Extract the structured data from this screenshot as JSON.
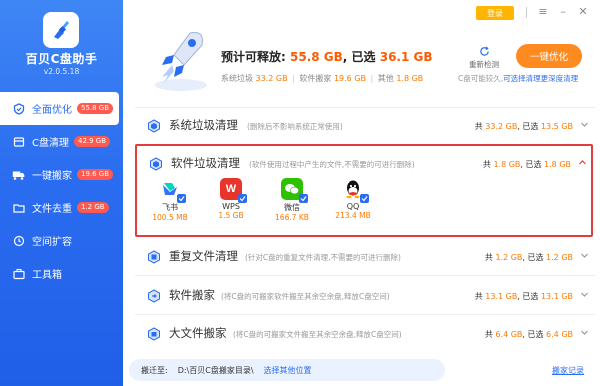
{
  "app": {
    "name": "百贝C盘助手",
    "version": "v2.0.5.18"
  },
  "header": {
    "login_label": "登录"
  },
  "nav": [
    {
      "label": "全面优化",
      "badge": "55.8 GB",
      "icon": "shield-icon",
      "active": true
    },
    {
      "label": "C盘清理",
      "badge": "42.9 GB",
      "icon": "broom-icon"
    },
    {
      "label": "一键搬家",
      "badge": "19.6 GB",
      "icon": "truck-icon"
    },
    {
      "label": "文件去重",
      "badge": "1.2 GB",
      "icon": "folder-icon"
    },
    {
      "label": "空间扩容",
      "badge": "",
      "icon": "expand-icon"
    },
    {
      "label": "工具箱",
      "badge": "",
      "icon": "toolbox-icon"
    }
  ],
  "summary": {
    "title_prefix": "预计可释放:",
    "total": "55.8 GB",
    "title_mid": ", 已选",
    "selected": "36.1 GB",
    "trash_label": "系统垃圾",
    "trash_value": "33.2 GB",
    "move_label": "软件搬家",
    "move_value": "19.6 GB",
    "other_label": "其他",
    "other_value": "1.8 GB"
  },
  "recheck_label": "重新检测",
  "optimize_label": "一键优化",
  "hint": {
    "text": "C盘可能较久,",
    "link": "可选择清理更深度清理"
  },
  "rows": [
    {
      "title": "系统垃圾清理",
      "desc": "(删除后不影响系统正常使用)",
      "total_prefix": "共",
      "total": "33.2 GB",
      "selected_prefix": ", 已选",
      "selected": "13.5 GB",
      "icon": "system-trash-icon"
    },
    {
      "title": "软件垃圾清理",
      "desc": "(软件使用过程中产生的文件,不需要的可进行删除)",
      "total_prefix": "共",
      "total": "1.8 GB",
      "selected_prefix": ", 已选",
      "selected": "1.8 GB",
      "icon": "software-trash-icon"
    },
    {
      "title": "重复文件清理",
      "desc": "(针对C盘的重复文件清理,不需要的可进行删除)",
      "total_prefix": "共",
      "total": "1.2 GB",
      "selected_prefix": ", 已选",
      "selected": "1.2 GB",
      "icon": "duplicate-icon"
    },
    {
      "title": "软件搬家",
      "desc": "(将C盘的可搬家软件搬至其余空余盘,释放C盘空间)",
      "total_prefix": "共",
      "total": "13.1 GB",
      "selected_prefix": ", 已选",
      "selected": "13.1 GB",
      "icon": "software-move-icon"
    },
    {
      "title": "大文件搬家",
      "desc": "(将C盘的可搬家文件搬至其余空余盘,释放C盘空间)",
      "total_prefix": "共",
      "total": "6.4 GB",
      "selected_prefix": ", 已选",
      "selected": "6.4 GB",
      "icon": "bigfile-move-icon"
    }
  ],
  "apps": [
    {
      "name": "飞书",
      "size": "100.5 MB",
      "icon": "feishu-icon",
      "color": "#1ec8b0"
    },
    {
      "name": "WPS",
      "size": "1.5 GB",
      "icon": "wps-icon",
      "color": "#e8342b"
    },
    {
      "name": "微信",
      "size": "166.7 KB",
      "icon": "wechat-icon",
      "color": "#2dc100"
    },
    {
      "name": "QQ",
      "size": "213.4 MB",
      "icon": "qq-icon",
      "color": "#111111"
    }
  ],
  "footer": {
    "move_to_label": "搬迁至:",
    "move_path": "D:\\百贝C盘搬家目录\\",
    "choose_other": "选择其他位置",
    "record": "搬家记录"
  }
}
